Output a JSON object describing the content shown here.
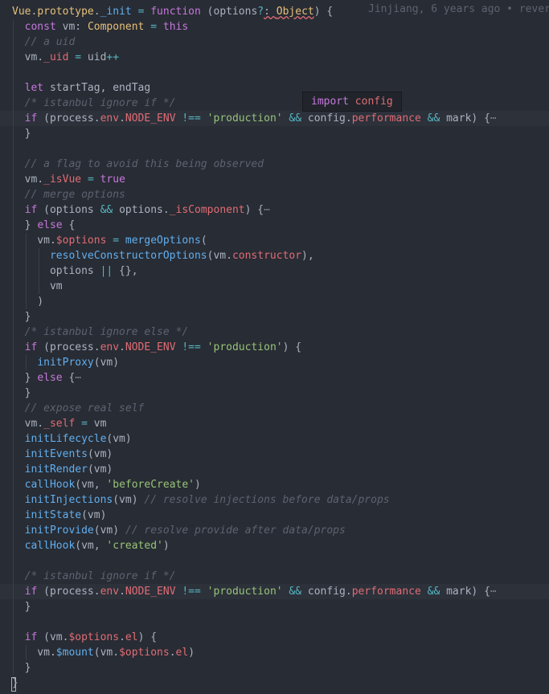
{
  "blame": "Jinjiang, 6 years ago • rever",
  "tooltip": {
    "keyword": "import",
    "name": "config"
  },
  "lines": [
    [
      [
        "type",
        "Vue"
      ],
      [
        "var",
        "."
      ],
      [
        "type",
        "prototype"
      ],
      [
        "var",
        "."
      ],
      [
        "fn",
        "_init"
      ],
      [
        "var",
        " "
      ],
      [
        "op",
        "="
      ],
      [
        "var",
        " "
      ],
      [
        "kw",
        "function"
      ],
      [
        "var",
        " (options"
      ],
      [
        "op",
        "?"
      ],
      [
        "var",
        ": "
      ],
      [
        "type",
        "Object"
      ],
      [
        "var",
        ") {"
      ]
    ],
    [
      [
        "var",
        "  "
      ],
      [
        "kw",
        "const"
      ],
      [
        "var",
        " vm: "
      ],
      [
        "type",
        "Component"
      ],
      [
        "var",
        " "
      ],
      [
        "op",
        "="
      ],
      [
        "var",
        " "
      ],
      [
        "kw",
        "this"
      ]
    ],
    [
      [
        "cmt",
        "  // a uid"
      ]
    ],
    [
      [
        "var",
        "  vm."
      ],
      [
        "prop",
        "_uid"
      ],
      [
        "var",
        " "
      ],
      [
        "op",
        "="
      ],
      [
        "var",
        " uid"
      ],
      [
        "op",
        "++"
      ]
    ],
    [],
    [
      [
        "var",
        "  "
      ],
      [
        "kw",
        "let"
      ],
      [
        "var",
        " startTag, endTag"
      ]
    ],
    [
      [
        "cmt",
        "  /* istanbul ignore if */"
      ]
    ],
    [
      [
        "var",
        "  "
      ],
      [
        "kw",
        "if"
      ],
      [
        "var",
        " (process."
      ],
      [
        "prop",
        "env"
      ],
      [
        "var",
        "."
      ],
      [
        "prop",
        "NODE_ENV"
      ],
      [
        "var",
        " "
      ],
      [
        "op",
        "!=="
      ],
      [
        "var",
        " "
      ],
      [
        "str",
        "'production'"
      ],
      [
        "var",
        " "
      ],
      [
        "op",
        "&&"
      ],
      [
        "var",
        " config."
      ],
      [
        "prop",
        "performance"
      ],
      [
        "var",
        " "
      ],
      [
        "op",
        "&&"
      ],
      [
        "var",
        " mark) {"
      ],
      [
        "fold",
        "⋯"
      ]
    ],
    [
      [
        "var",
        "  }"
      ]
    ],
    [],
    [
      [
        "cmt",
        "  // a flag to avoid this being observed"
      ]
    ],
    [
      [
        "var",
        "  vm."
      ],
      [
        "prop",
        "_isVue"
      ],
      [
        "var",
        " "
      ],
      [
        "op",
        "="
      ],
      [
        "var",
        " "
      ],
      [
        "kw",
        "true"
      ]
    ],
    [
      [
        "cmt",
        "  // merge options"
      ]
    ],
    [
      [
        "var",
        "  "
      ],
      [
        "kw",
        "if"
      ],
      [
        "var",
        " (options "
      ],
      [
        "op",
        "&&"
      ],
      [
        "var",
        " options."
      ],
      [
        "prop",
        "_isComponent"
      ],
      [
        "var",
        ") {"
      ],
      [
        "fold",
        "⋯"
      ]
    ],
    [
      [
        "var",
        "  } "
      ],
      [
        "kw",
        "else"
      ],
      [
        "var",
        " {"
      ]
    ],
    [
      [
        "var",
        "    vm."
      ],
      [
        "prop",
        "$options"
      ],
      [
        "var",
        " "
      ],
      [
        "op",
        "="
      ],
      [
        "var",
        " "
      ],
      [
        "fn",
        "mergeOptions"
      ],
      [
        "var",
        "("
      ]
    ],
    [
      [
        "var",
        "      "
      ],
      [
        "fn",
        "resolveConstructorOptions"
      ],
      [
        "var",
        "(vm."
      ],
      [
        "prop",
        "constructor"
      ],
      [
        "var",
        "),"
      ]
    ],
    [
      [
        "var",
        "      options "
      ],
      [
        "op",
        "||"
      ],
      [
        "var",
        " {},"
      ]
    ],
    [
      [
        "var",
        "      vm"
      ]
    ],
    [
      [
        "var",
        "    )"
      ]
    ],
    [
      [
        "var",
        "  }"
      ]
    ],
    [
      [
        "cmt",
        "  /* istanbul ignore else */"
      ]
    ],
    [
      [
        "var",
        "  "
      ],
      [
        "kw",
        "if"
      ],
      [
        "var",
        " (process."
      ],
      [
        "prop",
        "env"
      ],
      [
        "var",
        "."
      ],
      [
        "prop",
        "NODE_ENV"
      ],
      [
        "var",
        " "
      ],
      [
        "op",
        "!=="
      ],
      [
        "var",
        " "
      ],
      [
        "str",
        "'production'"
      ],
      [
        "var",
        ") {"
      ]
    ],
    [
      [
        "var",
        "    "
      ],
      [
        "fn",
        "initProxy"
      ],
      [
        "var",
        "(vm)"
      ]
    ],
    [
      [
        "var",
        "  } "
      ],
      [
        "kw",
        "else"
      ],
      [
        "var",
        " {"
      ],
      [
        "fold",
        "⋯"
      ]
    ],
    [
      [
        "var",
        "  }"
      ]
    ],
    [
      [
        "cmt",
        "  // expose real self"
      ]
    ],
    [
      [
        "var",
        "  vm."
      ],
      [
        "prop",
        "_self"
      ],
      [
        "var",
        " "
      ],
      [
        "op",
        "="
      ],
      [
        "var",
        " vm"
      ]
    ],
    [
      [
        "var",
        "  "
      ],
      [
        "fn",
        "initLifecycle"
      ],
      [
        "var",
        "(vm)"
      ]
    ],
    [
      [
        "var",
        "  "
      ],
      [
        "fn",
        "initEvents"
      ],
      [
        "var",
        "(vm)"
      ]
    ],
    [
      [
        "var",
        "  "
      ],
      [
        "fn",
        "initRender"
      ],
      [
        "var",
        "(vm)"
      ]
    ],
    [
      [
        "var",
        "  "
      ],
      [
        "fn",
        "callHook"
      ],
      [
        "var",
        "(vm, "
      ],
      [
        "str",
        "'beforeCreate'"
      ],
      [
        "var",
        ")"
      ]
    ],
    [
      [
        "var",
        "  "
      ],
      [
        "fn",
        "initInjections"
      ],
      [
        "var",
        "(vm) "
      ],
      [
        "cmt",
        "// resolve injections before data/props"
      ]
    ],
    [
      [
        "var",
        "  "
      ],
      [
        "fn",
        "initState"
      ],
      [
        "var",
        "(vm)"
      ]
    ],
    [
      [
        "var",
        "  "
      ],
      [
        "fn",
        "initProvide"
      ],
      [
        "var",
        "(vm) "
      ],
      [
        "cmt",
        "// resolve provide after data/props"
      ]
    ],
    [
      [
        "var",
        "  "
      ],
      [
        "fn",
        "callHook"
      ],
      [
        "var",
        "(vm, "
      ],
      [
        "str",
        "'created'"
      ],
      [
        "var",
        ")"
      ]
    ],
    [],
    [
      [
        "cmt",
        "  /* istanbul ignore if */"
      ]
    ],
    [
      [
        "var",
        "  "
      ],
      [
        "kw",
        "if"
      ],
      [
        "var",
        " (process."
      ],
      [
        "prop",
        "env"
      ],
      [
        "var",
        "."
      ],
      [
        "prop",
        "NODE_ENV"
      ],
      [
        "var",
        " "
      ],
      [
        "op",
        "!=="
      ],
      [
        "var",
        " "
      ],
      [
        "str",
        "'production'"
      ],
      [
        "var",
        " "
      ],
      [
        "op",
        "&&"
      ],
      [
        "var",
        " config."
      ],
      [
        "prop",
        "performance"
      ],
      [
        "var",
        " "
      ],
      [
        "op",
        "&&"
      ],
      [
        "var",
        " mark) {"
      ],
      [
        "fold",
        "⋯"
      ]
    ],
    [
      [
        "var",
        "  }"
      ]
    ],
    [],
    [
      [
        "var",
        "  "
      ],
      [
        "kw",
        "if"
      ],
      [
        "var",
        " (vm."
      ],
      [
        "prop",
        "$options"
      ],
      [
        "var",
        "."
      ],
      [
        "prop",
        "el"
      ],
      [
        "var",
        ") {"
      ]
    ],
    [
      [
        "var",
        "    vm."
      ],
      [
        "fn",
        "$mount"
      ],
      [
        "var",
        "(vm."
      ],
      [
        "prop",
        "$options"
      ],
      [
        "var",
        "."
      ],
      [
        "prop",
        "el"
      ],
      [
        "var",
        ")"
      ]
    ],
    [
      [
        "var",
        "  }"
      ]
    ],
    [
      [
        "var",
        "}"
      ]
    ]
  ]
}
